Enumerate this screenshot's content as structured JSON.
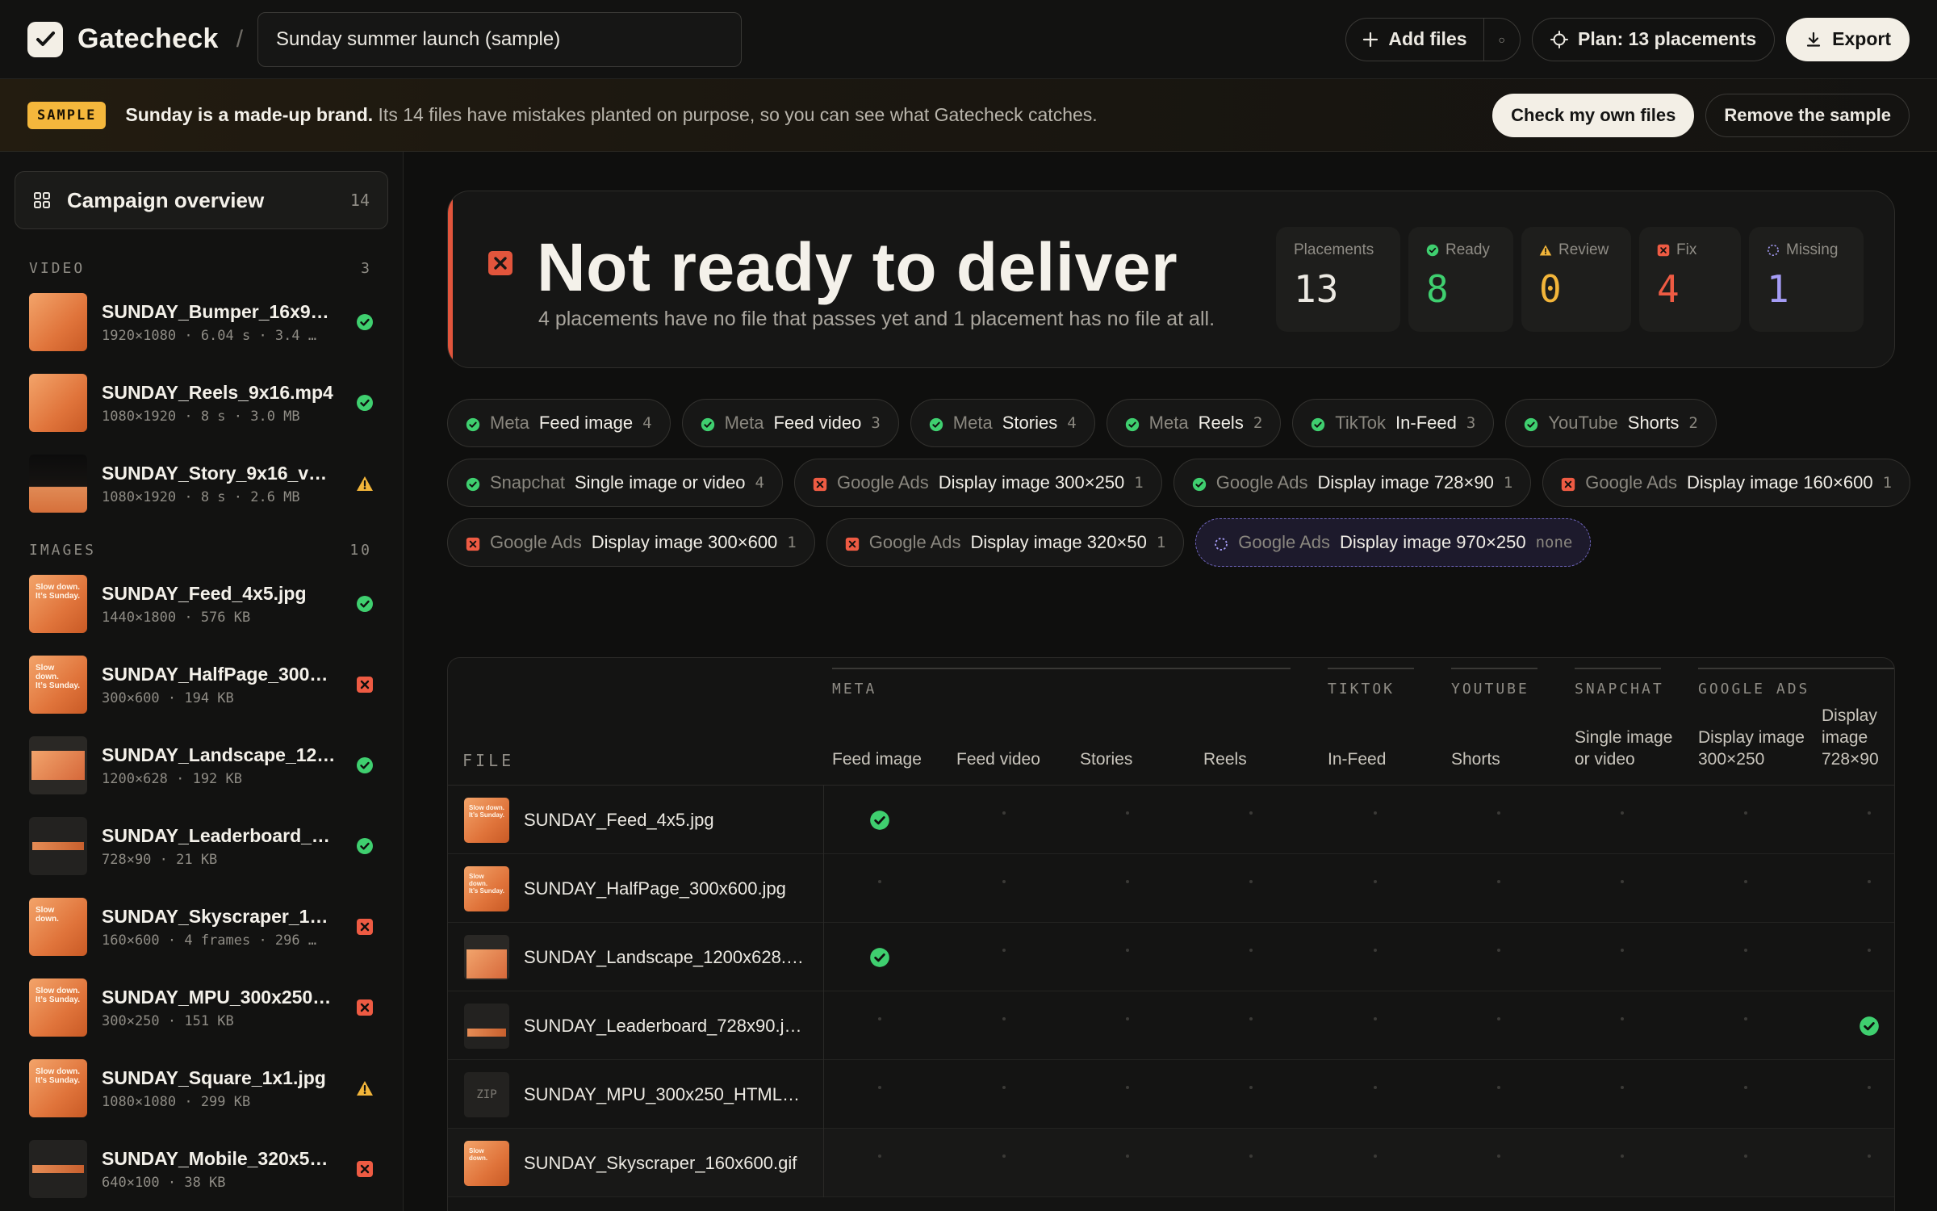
{
  "app": {
    "name": "Gatecheck",
    "project": "Sunday summer launch (sample)"
  },
  "header": {
    "add_files": "Add files",
    "more": "○",
    "plan": "Plan: 13 placements",
    "export": "Export"
  },
  "banner": {
    "tag": "SAMPLE",
    "bold": "Sunday is a made-up brand.",
    "text": " Its 14 files have mistakes planted on purpose, so you can see what Gatecheck catches.",
    "check_own": "Check my own files",
    "remove": "Remove the sample"
  },
  "sidebar": {
    "overview_label": "Campaign overview",
    "overview_count": "14",
    "video": {
      "title": "VIDEO",
      "count": "3",
      "items": [
        {
          "name": "SUNDAY_Bumper_16x9_6…",
          "meta": "1920×1080 · 6.04 s · 3.4 …",
          "status": "ok"
        },
        {
          "name": "SUNDAY_Reels_9x16.mp4",
          "meta": "1080×1920 · 8 s · 3.0 MB",
          "status": "ok"
        },
        {
          "name": "SUNDAY_Story_9x16_v2.…",
          "meta": "1080×1920 · 8 s · 2.6 MB",
          "status": "warn"
        }
      ]
    },
    "images": {
      "title": "IMAGES",
      "count": "10",
      "items": [
        {
          "name": "SUNDAY_Feed_4x5.jpg",
          "meta": "1440×1800 · 576 KB",
          "status": "ok"
        },
        {
          "name": "SUNDAY_HalfPage_300x…",
          "meta": "300×600 · 194 KB",
          "status": "fix"
        },
        {
          "name": "SUNDAY_Landscape_120…",
          "meta": "1200×628 · 192 KB",
          "status": "ok"
        },
        {
          "name": "SUNDAY_Leaderboard_72…",
          "meta": "728×90 · 21 KB",
          "status": "ok"
        },
        {
          "name": "SUNDAY_Skyscraper_160…",
          "meta": "160×600 · 4 frames · 296 …",
          "status": "fix"
        },
        {
          "name": "SUNDAY_MPU_300x250.…",
          "meta": "300×250 · 151 KB",
          "status": "fix"
        },
        {
          "name": "SUNDAY_Square_1x1.jpg",
          "meta": "1080×1080 · 299 KB",
          "status": "warn"
        },
        {
          "name": "SUNDAY_Mobile_320x50…",
          "meta": "640×100 · 38 KB",
          "status": "fix"
        }
      ]
    }
  },
  "verdict": {
    "title": "Not ready to deliver",
    "subtitle": "4 placements have no file that passes yet and 1 placement has no file at all.",
    "stats": [
      {
        "label": "Placements",
        "value": "13",
        "tone": "white",
        "icon": ""
      },
      {
        "label": "Ready",
        "value": "8",
        "tone": "green",
        "icon": "ok"
      },
      {
        "label": "Review",
        "value": "0",
        "tone": "amber",
        "icon": "warn"
      },
      {
        "label": "Fix",
        "value": "4",
        "tone": "red",
        "icon": "fix"
      },
      {
        "label": "Missing",
        "value": "1",
        "tone": "violet",
        "icon": "missing"
      }
    ]
  },
  "placements": [
    {
      "platform": "Meta",
      "name": "Feed image",
      "count": "4",
      "status": "ok"
    },
    {
      "platform": "Meta",
      "name": "Feed video",
      "count": "3",
      "status": "ok"
    },
    {
      "platform": "Meta",
      "name": "Stories",
      "count": "4",
      "status": "ok"
    },
    {
      "platform": "Meta",
      "name": "Reels",
      "count": "2",
      "status": "ok"
    },
    {
      "platform": "TikTok",
      "name": "In-Feed",
      "count": "3",
      "status": "ok"
    },
    {
      "platform": "YouTube",
      "name": "Shorts",
      "count": "2",
      "status": "ok"
    },
    {
      "platform": "Snapchat",
      "name": "Single image or video",
      "count": "4",
      "status": "ok"
    },
    {
      "platform": "Google Ads",
      "name": "Display image 300×250",
      "count": "1",
      "status": "fix"
    },
    {
      "platform": "Google Ads",
      "name": "Display image 728×90",
      "count": "1",
      "status": "ok"
    },
    {
      "platform": "Google Ads",
      "name": "Display image 160×600",
      "count": "1",
      "status": "fix"
    },
    {
      "platform": "Google Ads",
      "name": "Display image 300×600",
      "count": "1",
      "status": "fix"
    },
    {
      "platform": "Google Ads",
      "name": "Display image 320×50",
      "count": "1",
      "status": "fix"
    },
    {
      "platform": "Google Ads",
      "name": "Display image 970×250",
      "count": "none",
      "status": "missing"
    }
  ],
  "matrix": {
    "file_header": "FILE",
    "groups": [
      {
        "label": "META"
      },
      {
        "label": "TIKTOK"
      },
      {
        "label": "YOUTUBE"
      },
      {
        "label": "SNAPCHAT"
      },
      {
        "label": "GOOGLE ADS"
      }
    ],
    "columns": [
      "Feed image",
      "Feed video",
      "Stories",
      "Reels",
      "In-Feed",
      "Shorts",
      "Single image or video",
      "Display image 300×250",
      "Display image 728×90"
    ],
    "rows": [
      {
        "file": "SUNDAY_Feed_4x5.jpg",
        "cells": [
          1,
          0,
          0,
          0,
          0,
          0,
          0,
          0,
          0
        ]
      },
      {
        "file": "SUNDAY_HalfPage_300x600.jpg",
        "cells": [
          0,
          0,
          0,
          0,
          0,
          0,
          0,
          0,
          0
        ]
      },
      {
        "file": "SUNDAY_Landscape_1200x628.…",
        "cells": [
          1,
          0,
          0,
          0,
          0,
          0,
          0,
          0,
          0
        ]
      },
      {
        "file": "SUNDAY_Leaderboard_728x90.j…",
        "cells": [
          0,
          0,
          0,
          0,
          0,
          0,
          0,
          0,
          1
        ]
      },
      {
        "file": "SUNDAY_MPU_300x250_HTML…",
        "thumb": "ZIP",
        "cells": [
          0,
          0,
          0,
          0,
          0,
          0,
          0,
          0,
          0
        ]
      },
      {
        "file": "SUNDAY_Skyscraper_160x600.gif",
        "cells": [
          0,
          0,
          0,
          0,
          0,
          0,
          0,
          0,
          0
        ]
      }
    ]
  }
}
